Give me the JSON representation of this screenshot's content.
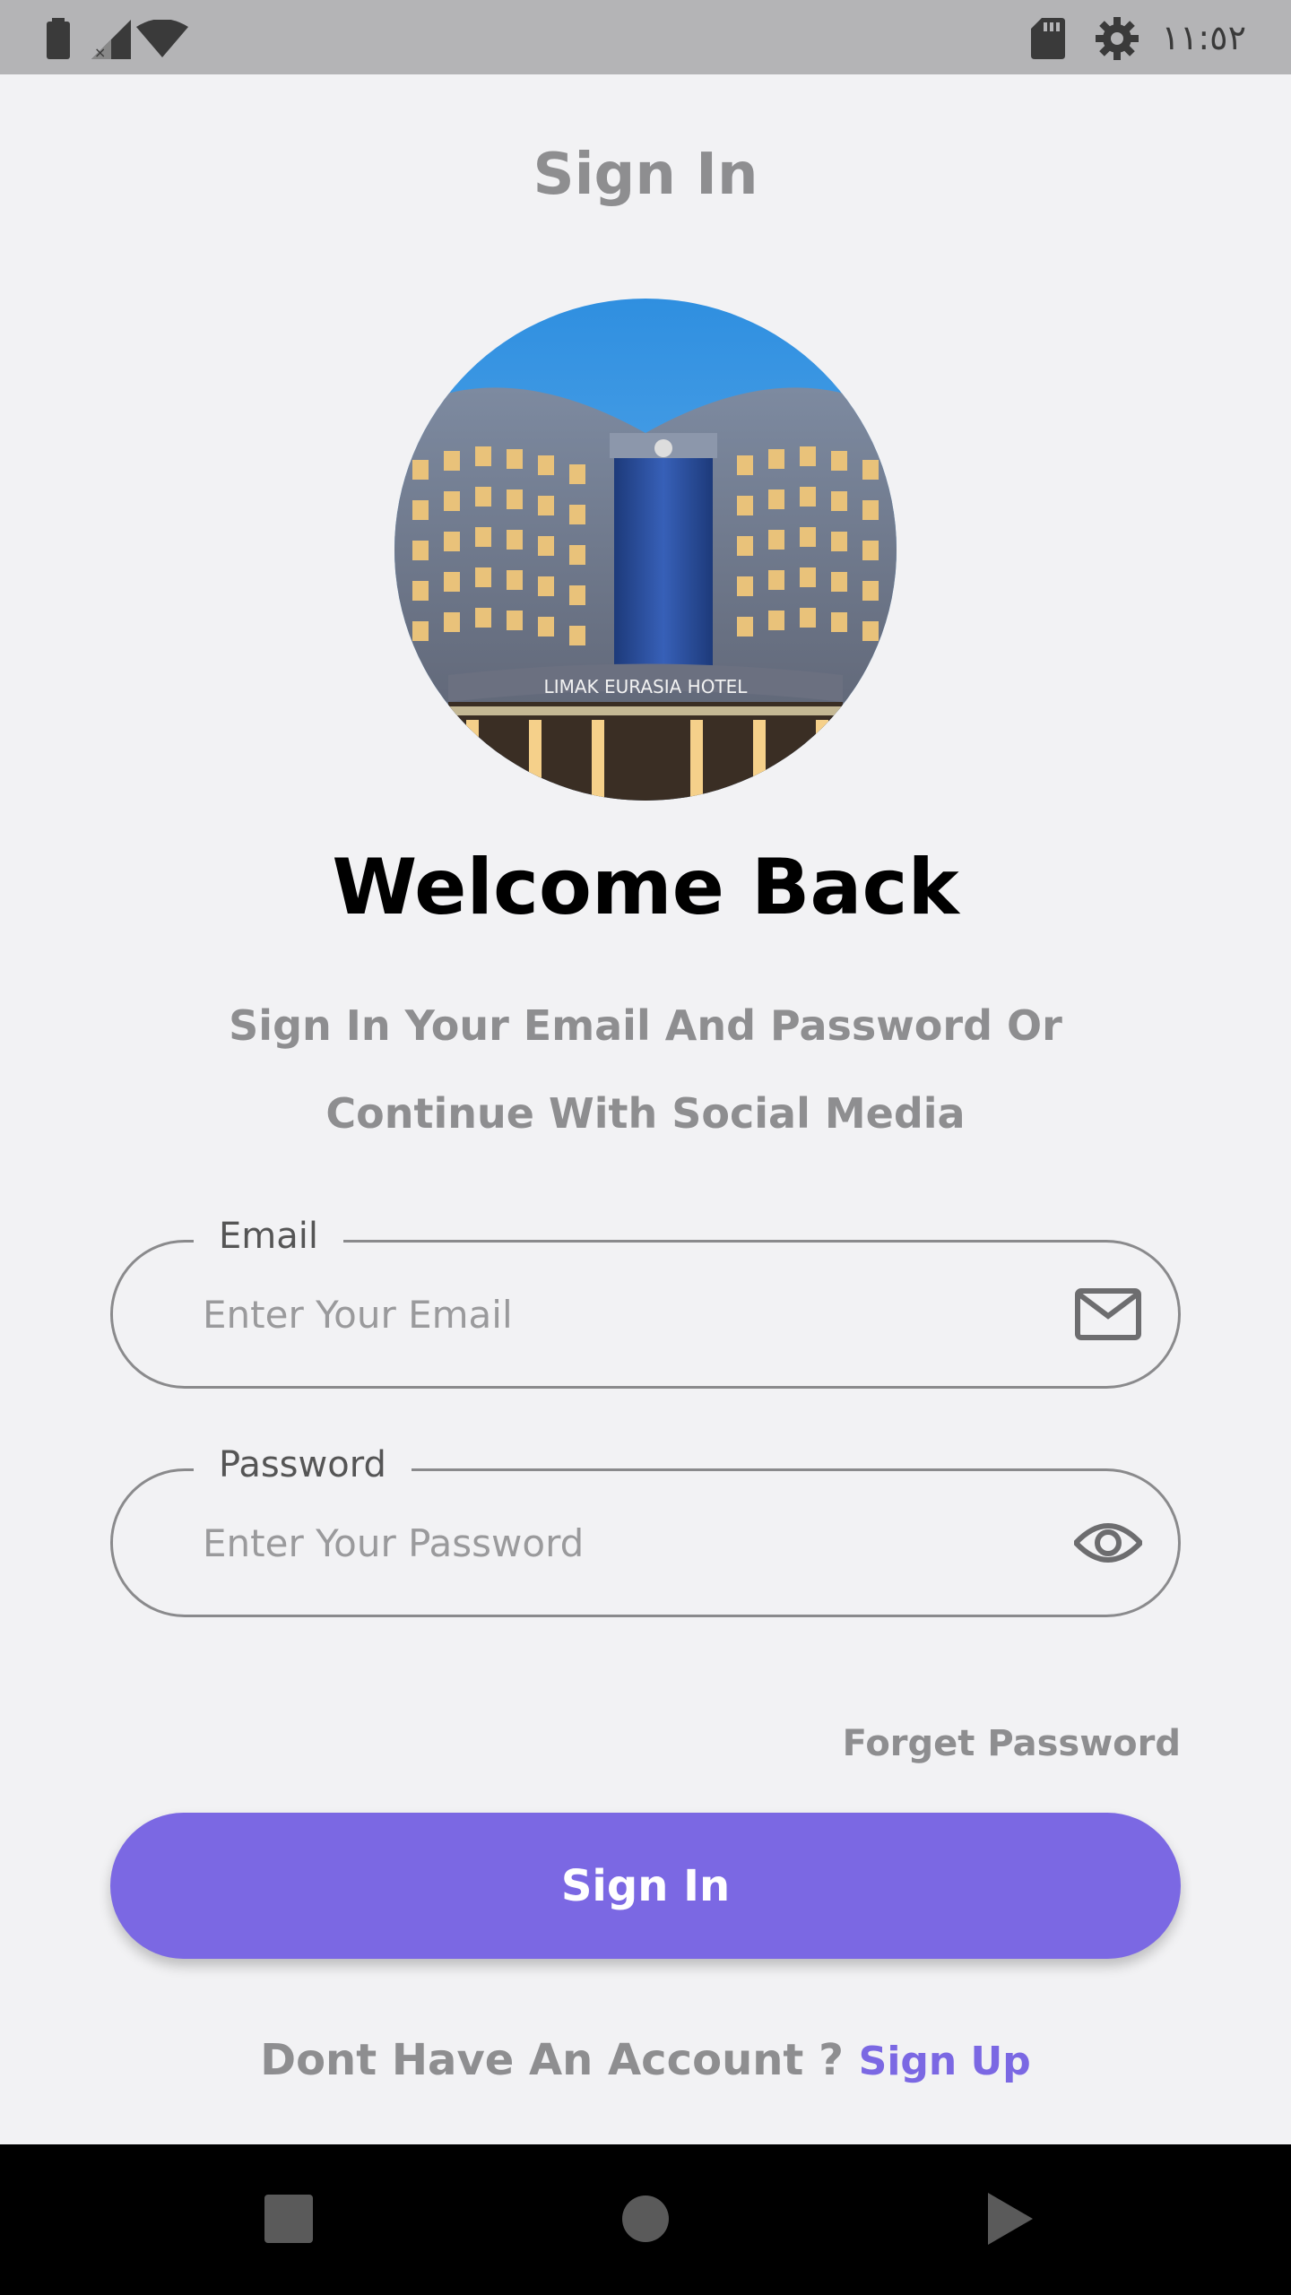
{
  "status_bar": {
    "time": "١١:٥٢",
    "icons": [
      "battery-icon",
      "no-signal-icon",
      "wifi-icon",
      "sd-card-icon",
      "settings-gear-icon"
    ]
  },
  "header": {
    "title": "Sign In"
  },
  "hero": {
    "image_icon": "hotel-photo",
    "sign_text": "LIMAK EURASIA HOTEL"
  },
  "welcome": {
    "title": "Welcome Back",
    "subtitle": "Sign In Your Email And Password Or Continue With Social Media"
  },
  "form": {
    "email": {
      "label": "Email",
      "placeholder": "Enter Your Email",
      "value": "",
      "icon": "mail-icon"
    },
    "password": {
      "label": "Password",
      "placeholder": "Enter Your Password",
      "value": "",
      "icon": "eye-icon"
    },
    "forgot_label": "Forget Password",
    "submit_label": "Sign In"
  },
  "footer": {
    "prompt": "Dont Have An Account ?",
    "signup_label": "Sign Up"
  },
  "nav": {
    "icons": [
      "recents-square-icon",
      "home-circle-icon",
      "back-triangle-icon"
    ]
  },
  "colors": {
    "accent": "#7b68e3",
    "status_bar": "#b4b4b6",
    "background": "#f2f2f4",
    "muted_text": "#8e8e90"
  }
}
